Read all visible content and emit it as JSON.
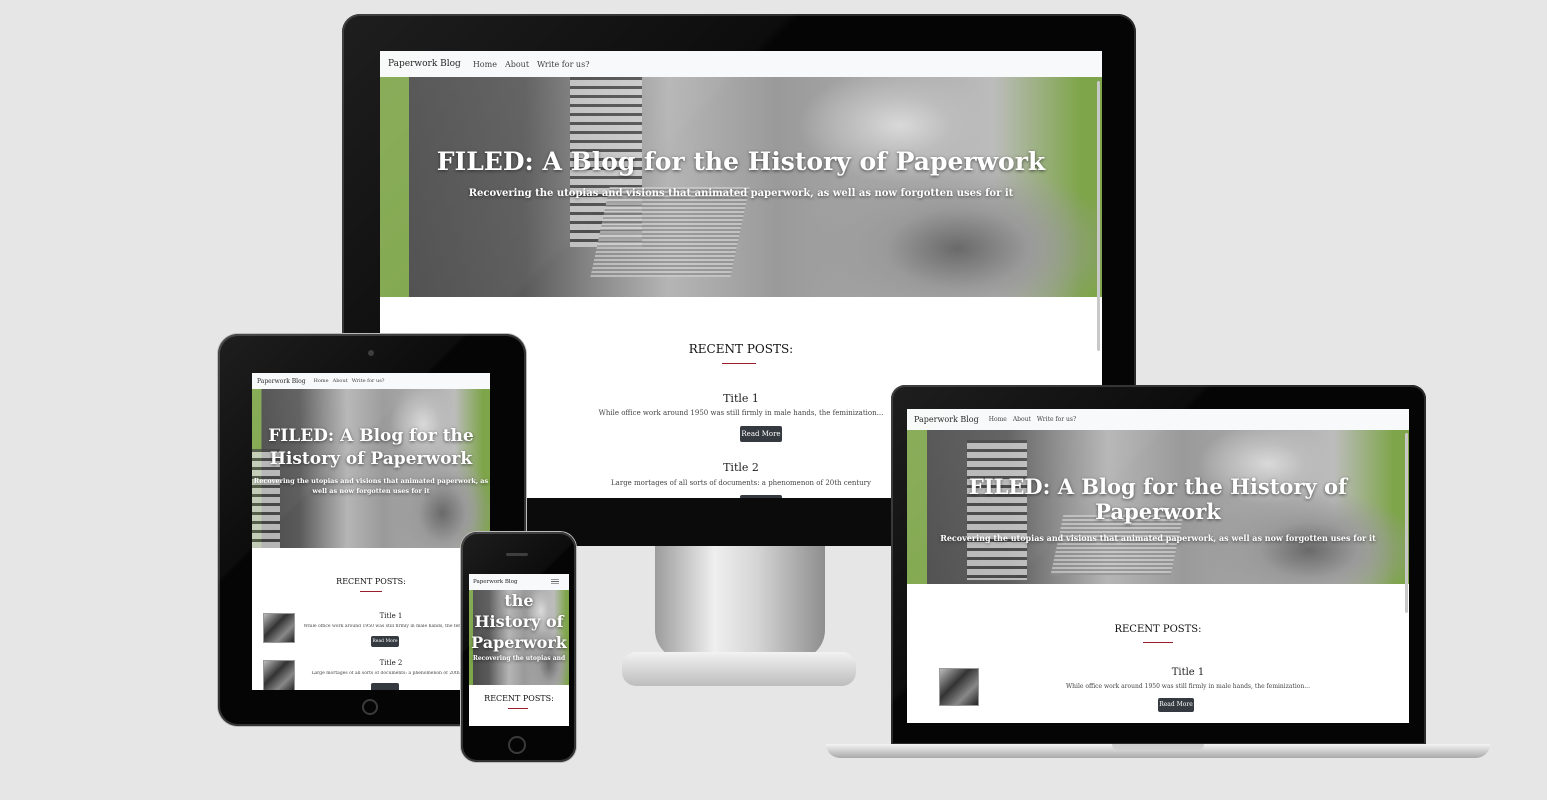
{
  "site": {
    "brand": "Paperwork Blog",
    "nav": [
      "Home",
      "About",
      "Write for us?"
    ],
    "hero_title": "FILED: A Blog for the History of Paperwork",
    "hero_subtitle": "Recovering the utopias and visions that animated paperwork, as well as now forgotten uses for it",
    "section_title": "RECENT POSTS:",
    "read_more": "Read More",
    "posts": [
      {
        "title": "Title 1",
        "excerpt": "While office work around 1950 was still firmly in male hands, the feminization..."
      },
      {
        "title": "Title 2",
        "excerpt": "Large mortages of all sorts of documents: a phenomenon of 20th century"
      }
    ]
  },
  "phone": {
    "hero_lines": [
      "the",
      "History of",
      "Paperwork"
    ],
    "hero_sub_partial": "Recovering the utopias and",
    "menu_icon": "hamburger-icon"
  },
  "tablet": {
    "hero_lines": [
      "FILED: A Blog for the",
      "History of Paperwork"
    ],
    "hero_sub_lines": [
      "Recovering the utopias and visions that animated paperwork, as",
      "well as now forgotten uses for it"
    ]
  },
  "devices": [
    "desktop-monitor",
    "laptop",
    "tablet",
    "phone"
  ]
}
